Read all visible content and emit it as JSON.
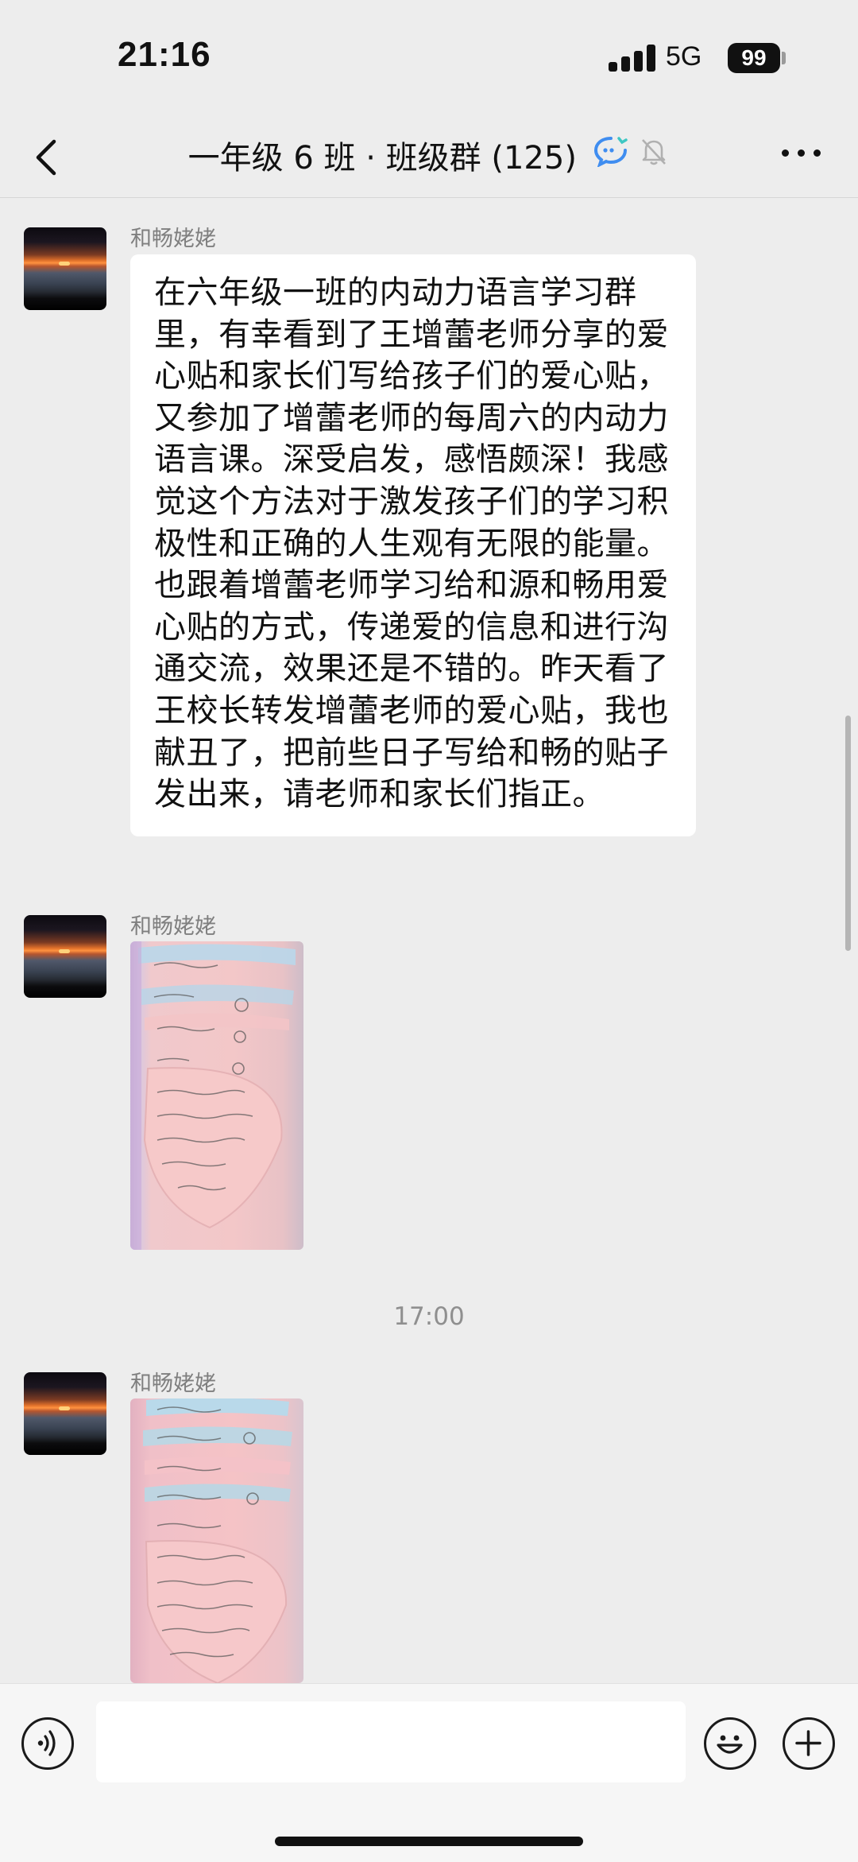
{
  "status_bar": {
    "time": "21:16",
    "network": "5G",
    "battery": "99"
  },
  "nav": {
    "title": "一年级 6 班 · 班级群 (125)",
    "icons": [
      "back-icon",
      "chat-bubble-icon",
      "mute-bell-icon",
      "more-icon"
    ]
  },
  "messages": [
    {
      "sender": "和畅姥姥",
      "type": "text",
      "text": "在六年级一班的内动力语言学习群里，有幸看到了王增蕾老师分享的爱心贴和家长们写给孩子们的爱心贴，又参加了增蕾老师的每周六的内动力语言课。深受启发，感悟颇深！我感觉这个方法对于激发孩子们的学习积极性和正确的人生观有无限的能量。也跟着增蕾老师学习给和源和畅用爱心贴的方式，传递爱的信息和进行沟通交流，效果还是不错的。昨天看了王校长转发增蕾老师的爱心贴，我也献丑了，把前些日子写给和畅的贴子发出来，请老师和家长们指正。"
    },
    {
      "sender": "和畅姥姥",
      "type": "image"
    },
    {
      "sender": "和畅姥姥",
      "type": "image"
    }
  ],
  "timestamp": "17:00",
  "input_bar": {
    "placeholder": "",
    "icons": [
      "voice-icon",
      "emoji-icon",
      "plus-icon"
    ]
  }
}
